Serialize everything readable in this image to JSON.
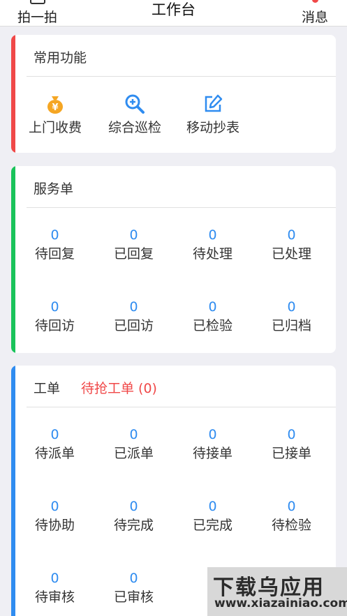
{
  "header": {
    "left_label": "拍一拍",
    "title": "工作台",
    "right_label": "消息"
  },
  "common": {
    "title": "常用功能",
    "items": [
      {
        "label": "上门收费",
        "icon": "money-bag-icon"
      },
      {
        "label": "综合巡检",
        "icon": "zoom-in-icon"
      },
      {
        "label": "移动抄表",
        "icon": "edit-icon"
      }
    ]
  },
  "service": {
    "title": "服务单",
    "items": [
      {
        "count": "0",
        "label": "待回复"
      },
      {
        "count": "0",
        "label": "已回复"
      },
      {
        "count": "0",
        "label": "待处理"
      },
      {
        "count": "0",
        "label": "已处理"
      },
      {
        "count": "0",
        "label": "待回访"
      },
      {
        "count": "0",
        "label": "已回访"
      },
      {
        "count": "0",
        "label": "已检验"
      },
      {
        "count": "0",
        "label": "已归档"
      }
    ]
  },
  "work": {
    "title": "工单",
    "grab_label": "待抢工单 (0)",
    "items": [
      {
        "count": "0",
        "label": "待派单"
      },
      {
        "count": "0",
        "label": "已派单"
      },
      {
        "count": "0",
        "label": "待接单"
      },
      {
        "count": "0",
        "label": "已接单"
      },
      {
        "count": "0",
        "label": "待协助"
      },
      {
        "count": "0",
        "label": "待完成"
      },
      {
        "count": "0",
        "label": "已完成"
      },
      {
        "count": "0",
        "label": "待检验"
      },
      {
        "count": "0",
        "label": "待审核"
      },
      {
        "count": "0",
        "label": "已审核"
      }
    ]
  },
  "watermark": {
    "line1": "下载乌应用",
    "line2": "www.xiazainiao.com"
  },
  "colors": {
    "accent_red": "#f04848",
    "accent_green": "#19c35a",
    "accent_blue": "#2f8cf0",
    "icon_orange": "#f5a623",
    "number_blue": "#2f8cf0"
  }
}
